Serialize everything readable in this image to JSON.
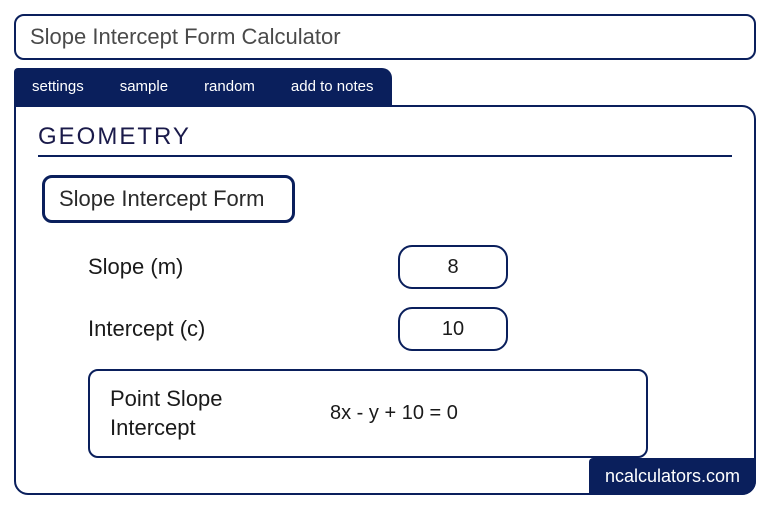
{
  "title": "Slope Intercept Form Calculator",
  "tabs": {
    "settings": "settings",
    "sample": "sample",
    "random": "random",
    "add_to_notes": "add to notes"
  },
  "section_heading": "GEOMETRY",
  "form_title": "Slope Intercept Form",
  "fields": {
    "slope": {
      "label": "Slope (m)",
      "value": "8"
    },
    "intercept": {
      "label": "Intercept (c)",
      "value": "10"
    }
  },
  "result": {
    "label": "Point Slope Intercept",
    "value": "8x - y + 10 = 0"
  },
  "brand": "ncalculators.com"
}
